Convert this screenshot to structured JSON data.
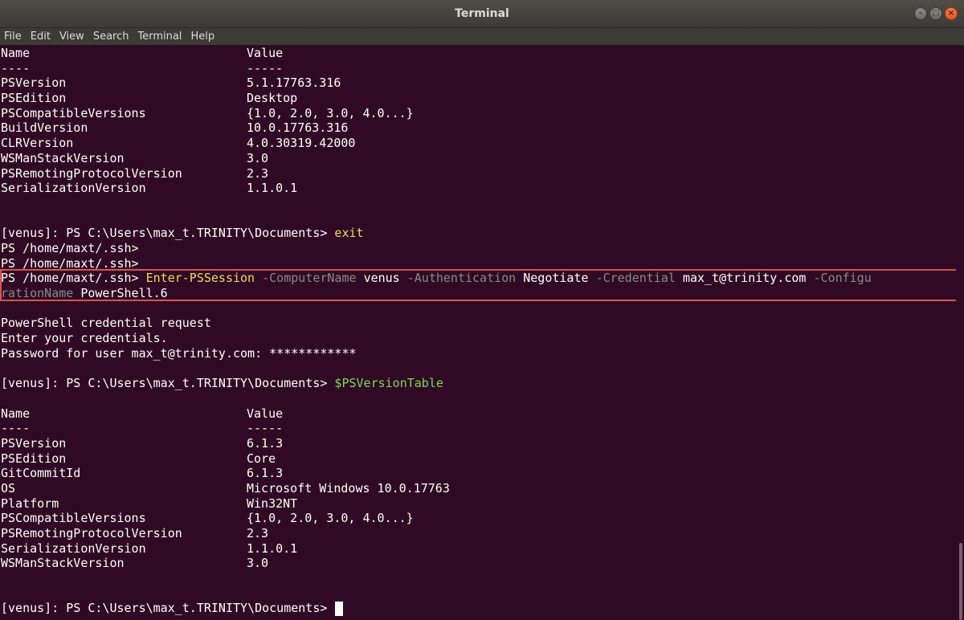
{
  "window": {
    "title": "Terminal",
    "controls": [
      "–",
      "□",
      "×"
    ]
  },
  "menu": [
    "File",
    "Edit",
    "View",
    "Search",
    "Terminal",
    "Help"
  ],
  "table1": {
    "header": [
      "Name",
      "Value"
    ],
    "divider": [
      "----",
      "-----"
    ],
    "rows": [
      [
        "PSVersion",
        "5.1.17763.316"
      ],
      [
        "PSEdition",
        "Desktop"
      ],
      [
        "PSCompatibleVersions",
        "{1.0, 2.0, 3.0, 4.0...}"
      ],
      [
        "BuildVersion",
        "10.0.17763.316"
      ],
      [
        "CLRVersion",
        "4.0.30319.42000"
      ],
      [
        "WSManStackVersion",
        "3.0"
      ],
      [
        "PSRemotingProtocolVersion",
        "2.3"
      ],
      [
        "SerializationVersion",
        "1.1.0.1"
      ]
    ]
  },
  "remote_prompt": "[venus]: PS C:\\Users\\max_t.TRINITY\\Documents> ",
  "exit_cmd": "exit",
  "local_prompt": "PS /home/maxt/.ssh> ",
  "local_prompt_bare": "PS /home/maxt/.ssh>",
  "enter_session": {
    "cmd": "Enter-PSSession",
    "p1": "-ComputerName",
    "v1": "venus",
    "p2": "-Authentication",
    "v2": "Negotiate",
    "p3": "-Credential",
    "v3": "max_t@trinity.com",
    "p4a": "-Configu",
    "p4b": "rationName",
    "v4": "PowerShell.6"
  },
  "cred": {
    "title": "PowerShell credential request",
    "prompt": "Enter your credentials.",
    "password_line": "Password for user max_t@trinity.com: ************"
  },
  "version_table_cmd": "$PSVersionTable",
  "table2": {
    "header": [
      "Name",
      "Value"
    ],
    "divider": [
      "----",
      "-----"
    ],
    "rows": [
      [
        "PSVersion",
        "6.1.3"
      ],
      [
        "PSEdition",
        "Core"
      ],
      [
        "GitCommitId",
        "6.1.3"
      ],
      [
        "OS",
        "Microsoft Windows 10.0.17763"
      ],
      [
        "Platform",
        "Win32NT"
      ],
      [
        "PSCompatibleVersions",
        "{1.0, 2.0, 3.0, 4.0...}"
      ],
      [
        "PSRemotingProtocolVersion",
        "2.3"
      ],
      [
        "SerializationVersion",
        "1.1.0.1"
      ],
      [
        "WSManStackVersion",
        "3.0"
      ]
    ]
  },
  "colors": {
    "background": "#300a24",
    "text": "#ffffff",
    "command": "#eedc62",
    "parameter": "#8a8a8a",
    "variable": "#7ed957",
    "highlight_box": "#d9534f"
  }
}
